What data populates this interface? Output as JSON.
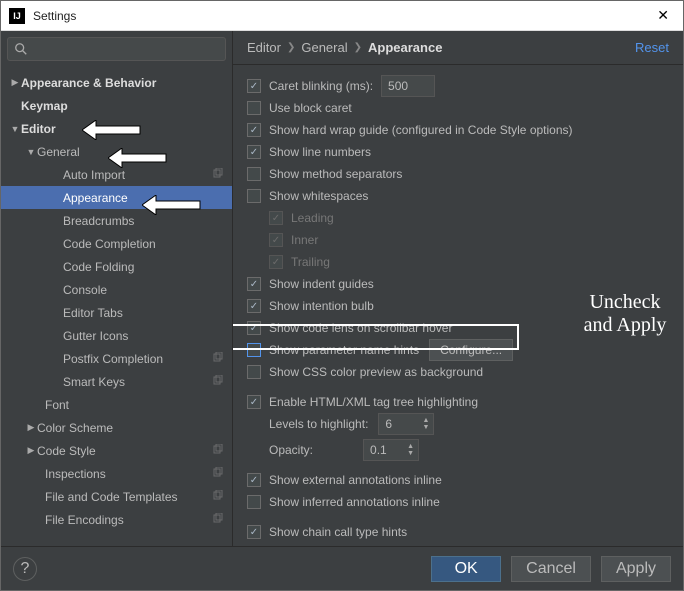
{
  "window": {
    "title": "Settings",
    "close": "✕",
    "logo": "IJ"
  },
  "breadcrumb": {
    "a": "Editor",
    "b": "General",
    "c": "Appearance",
    "reset": "Reset"
  },
  "tree": {
    "appearance_behavior": "Appearance & Behavior",
    "keymap": "Keymap",
    "editor": "Editor",
    "general": "General",
    "auto_import": "Auto Import",
    "appearance": "Appearance",
    "breadcrumbs": "Breadcrumbs",
    "code_completion": "Code Completion",
    "code_folding": "Code Folding",
    "console": "Console",
    "editor_tabs": "Editor Tabs",
    "gutter_icons": "Gutter Icons",
    "postfix_completion": "Postfix Completion",
    "smart_keys": "Smart Keys",
    "font": "Font",
    "color_scheme": "Color Scheme",
    "code_style": "Code Style",
    "inspections": "Inspections",
    "file_code_templates": "File and Code Templates",
    "file_encodings": "File Encodings"
  },
  "opts": {
    "caret_blinking": "Caret blinking (ms):",
    "caret_blinking_val": "500",
    "use_block_caret": "Use block caret",
    "hard_wrap": "Show hard wrap guide (configured in Code Style options)",
    "line_numbers": "Show line numbers",
    "method_sep": "Show method separators",
    "whitespaces": "Show whitespaces",
    "ws_leading": "Leading",
    "ws_inner": "Inner",
    "ws_trailing": "Trailing",
    "indent_guides": "Show indent guides",
    "intention_bulb": "Show intention bulb",
    "code_lens": "Show code lens on scrollbar hover",
    "param_hints": "Show parameter name hints",
    "configure": "Configure...",
    "css_preview": "Show CSS color preview as background",
    "html_tag_tree": "Enable HTML/XML tag tree highlighting",
    "levels": "Levels to highlight:",
    "levels_val": "6",
    "opacity": "Opacity:",
    "opacity_val": "0.1",
    "ext_annot": "Show external annotations inline",
    "inf_annot": "Show inferred annotations inline",
    "chain_hints": "Show chain call type hints"
  },
  "footer": {
    "help": "?",
    "ok": "OK",
    "cancel": "Cancel",
    "apply": "Apply"
  },
  "annot": {
    "text": "Uncheck\nand\nApply"
  }
}
